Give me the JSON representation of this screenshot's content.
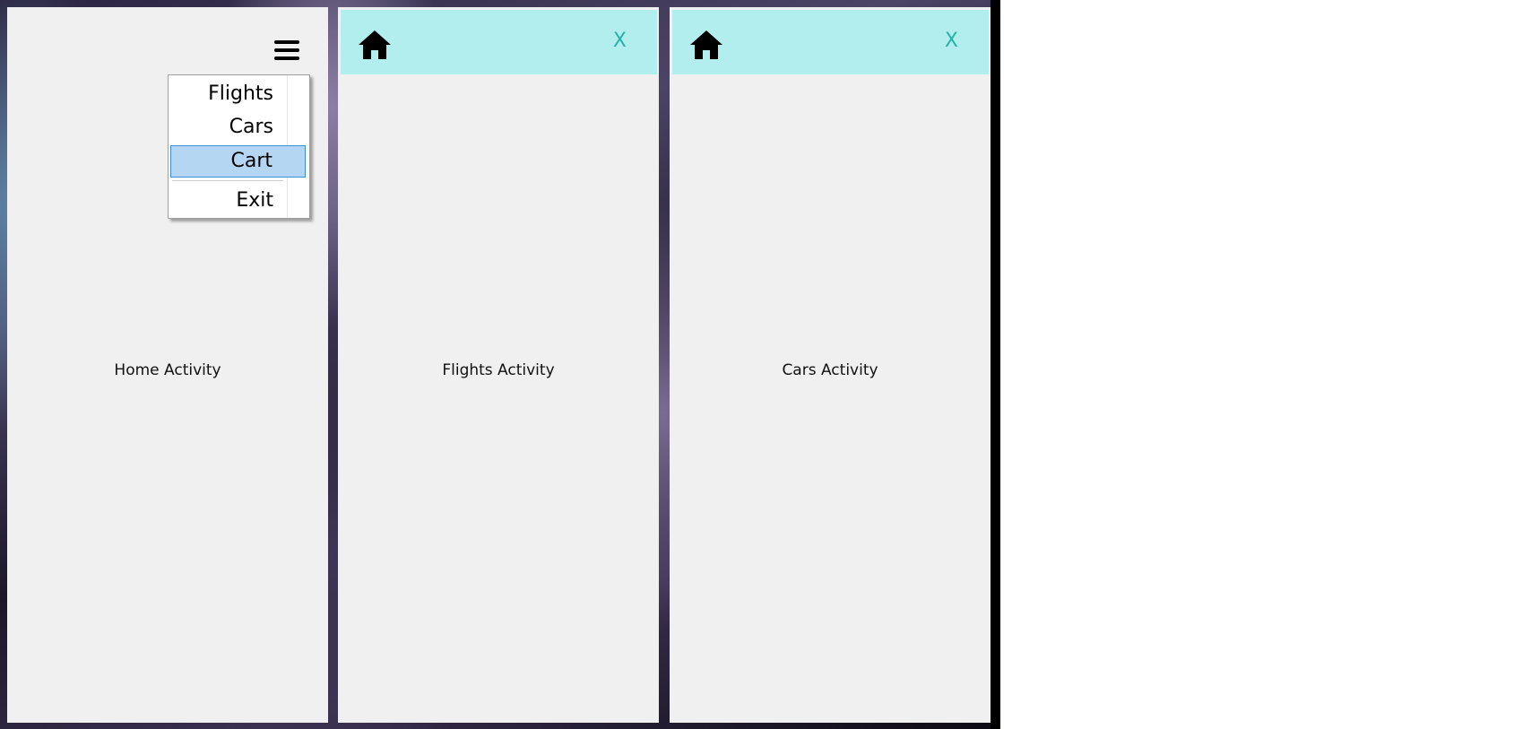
{
  "home": {
    "menu": {
      "items": [
        {
          "label": "Flights"
        },
        {
          "label": "Cars"
        },
        {
          "label": "Cart",
          "selected": true
        },
        {
          "label": "Exit"
        }
      ]
    },
    "label": "Home Activity"
  },
  "flights": {
    "close_label": "X",
    "label": "Flights Activity"
  },
  "cars": {
    "close_label": "X",
    "label": "Cars Activity"
  },
  "icons": {
    "menu": "hamburger-menu-icon",
    "home": "home-icon"
  },
  "colors": {
    "topbar": "#b2eeee",
    "close": "#28b0a8",
    "selection": "#b5d6f2",
    "selection_border": "#3d8fd6",
    "window_bg": "#f0f0f0"
  }
}
